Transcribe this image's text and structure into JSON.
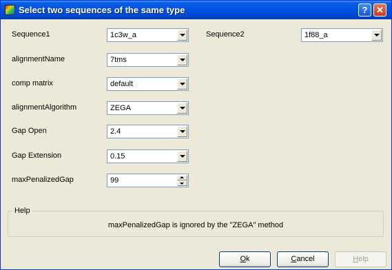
{
  "window": {
    "title": "Select two sequences of the same type",
    "help_glyph": "?",
    "close_glyph": "✕"
  },
  "fields": {
    "sequence1": {
      "label": "Sequence1",
      "value": "1c3w_a"
    },
    "sequence2": {
      "label": "Sequence2",
      "value": "1f88_a"
    },
    "alignment_name": {
      "label": "alignmentName",
      "value": "7tms"
    },
    "comp_matrix": {
      "label": "comp matrix",
      "value": "default"
    },
    "alignment_algorithm": {
      "label": "alignmentAlgorithm",
      "value": "ZEGA"
    },
    "gap_open": {
      "label": "Gap Open",
      "value": "2.4"
    },
    "gap_extension": {
      "label": "Gap Extension",
      "value": "0.15"
    },
    "max_penalized_gap": {
      "label": "maxPenalizedGap",
      "value": "99"
    }
  },
  "help": {
    "title": "Help",
    "text": "maxPenalizedGap is ignored by the \"ZEGA\" method"
  },
  "buttons": {
    "ok_mnemonic": "O",
    "ok_rest": "k",
    "cancel_mnemonic": "C",
    "cancel_rest": "ancel",
    "help_mnemonic": "H",
    "help_rest": "elp"
  }
}
